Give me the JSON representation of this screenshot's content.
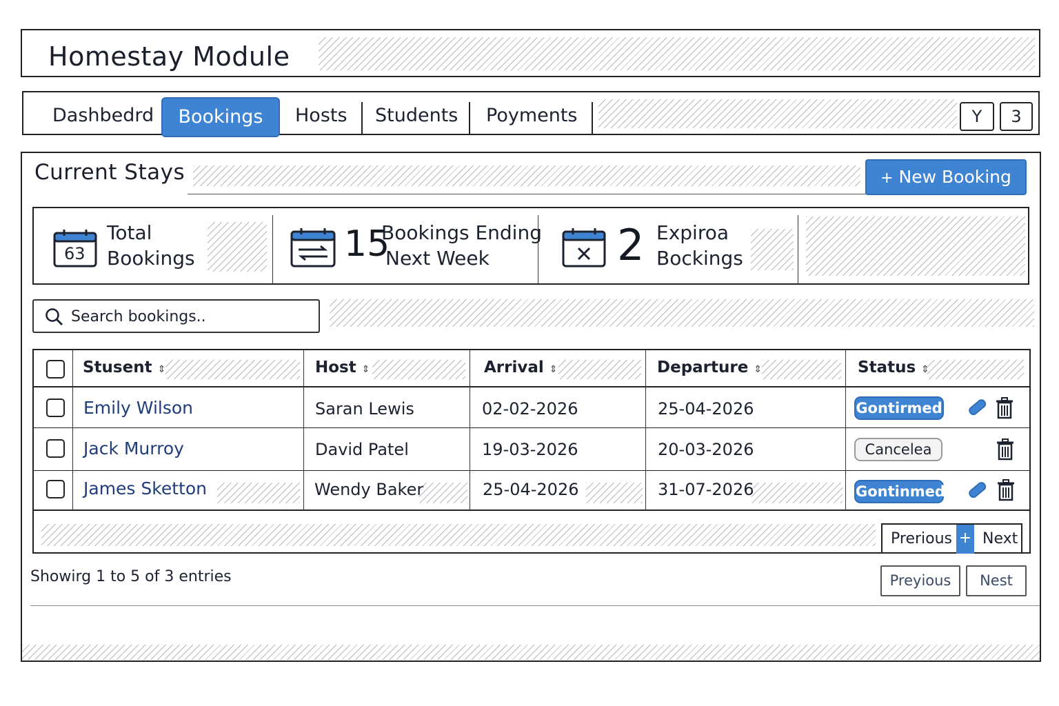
{
  "app": {
    "title": "Homestay Module"
  },
  "tabs": [
    {
      "label": "Dashbedrd"
    },
    {
      "label": "Bookings",
      "active": true
    },
    {
      "label": "Hosts"
    },
    {
      "label": "Students"
    },
    {
      "label": "Poyments"
    }
  ],
  "toolbar": {
    "filter_icon_label": "Y",
    "count_label": "3"
  },
  "section": {
    "title": "Current Stays",
    "new_button_label": "New Booking",
    "new_button_icon": "plus-icon"
  },
  "stats": [
    {
      "icon": "calendar-icon",
      "icon_text": "63",
      "label_line1": "Total",
      "label_line2": "Bookings"
    },
    {
      "icon": "calendar-swap-icon",
      "number": "15",
      "label_line1": "Bookings Ending",
      "label_line2": "Next Week"
    },
    {
      "icon": "calendar-x-icon",
      "number": "2",
      "label_line1": "Expiroa",
      "label_line2": "Bockings"
    }
  ],
  "search": {
    "placeholder": "Search bookings..",
    "value": ""
  },
  "table": {
    "columns": [
      "Stusent",
      "Host",
      "Arrival",
      "Departure",
      "Status"
    ],
    "rows": [
      {
        "student": "Emily Wilson",
        "host": "Saran Lewis",
        "arrival": "02-02-2026",
        "departure": "25-04-2026",
        "status": "Gontirmed",
        "status_type": "confirmed",
        "editable": true
      },
      {
        "student": "Jack Murroy",
        "host": "David Patel",
        "arrival": "19-03-2026",
        "departure": "20-03-2026",
        "status": "Cancelea",
        "status_type": "cancelled",
        "editable": false
      },
      {
        "student": "James Sketton",
        "host": "Wendy Baker",
        "arrival": "25-04-2026",
        "departure": "31-07-2026",
        "status": "Gontinmed",
        "status_type": "confirmed",
        "editable": true
      }
    ]
  },
  "inner_pagination": {
    "prev_label": "Prerious",
    "mid_label": "+",
    "next_label": "Next"
  },
  "footer": {
    "entries_text": "Showirg 1 to 5 of 3 entries",
    "prev_label": "Preyious",
    "next_label": "Nest"
  },
  "colors": {
    "accent": "#3f84d2",
    "accent_border": "#2e6db7",
    "link": "#1f3d7a"
  }
}
